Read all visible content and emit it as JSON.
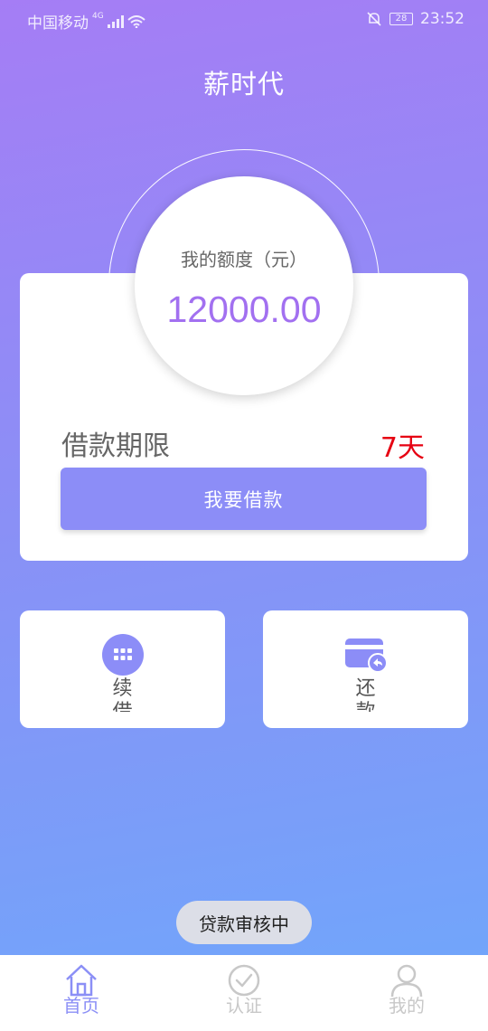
{
  "status_bar": {
    "carrier": "中国移动",
    "network": "4G",
    "battery": "28",
    "time": "23:52"
  },
  "header": {
    "title": "薪时代"
  },
  "quota": {
    "label": "我的额度（元）",
    "amount": "12000.00"
  },
  "loan": {
    "term_label": "借款期限",
    "term_value": "7天",
    "borrow_label": "我要借款"
  },
  "actions": [
    {
      "label": "续借",
      "icon": "grid-icon"
    },
    {
      "label": "还款",
      "icon": "card-repay-icon"
    }
  ],
  "toast": {
    "text": "贷款审核中"
  },
  "tabs": [
    {
      "label": "首页",
      "icon": "home-icon",
      "active": true
    },
    {
      "label": "认证",
      "icon": "check-circle-icon",
      "active": false
    },
    {
      "label": "我的",
      "icon": "user-icon",
      "active": false
    }
  ],
  "colors": {
    "accent": "#8c8df7",
    "amount": "#a270f0",
    "term_value": "#e60012",
    "inactive_tab": "#c8c8c8"
  }
}
